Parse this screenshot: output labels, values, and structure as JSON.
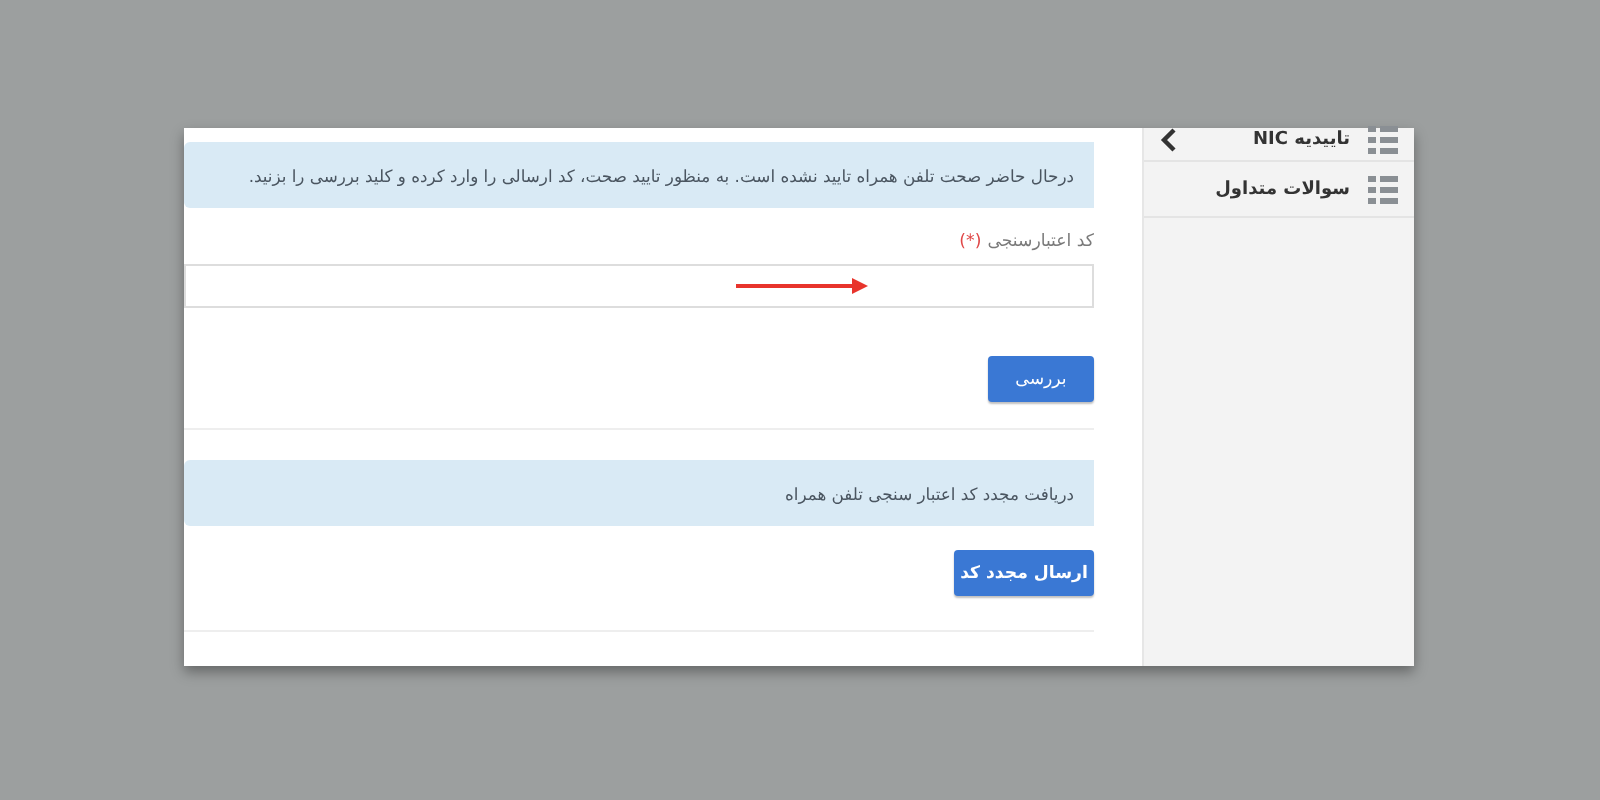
{
  "sidebar": {
    "items": [
      {
        "label": "تاییدیه NIC",
        "expanded": true
      },
      {
        "label": "سوالات متداول",
        "expanded": false
      }
    ]
  },
  "verify": {
    "notice": "درحال حاضر صحت تلفن همراه تایید نشده است. به منظور تایید صحت، کد ارسالی را وارد کرده و کلید بررسی را بزنید.",
    "field_label": "کد اعتبارسنجی",
    "required_mark": "(*)",
    "button": "بررسی"
  },
  "resend": {
    "notice": "دریافت مجدد کد اعتبار سنجی تلفن همراه",
    "button": "ارسال مجدد کد"
  }
}
